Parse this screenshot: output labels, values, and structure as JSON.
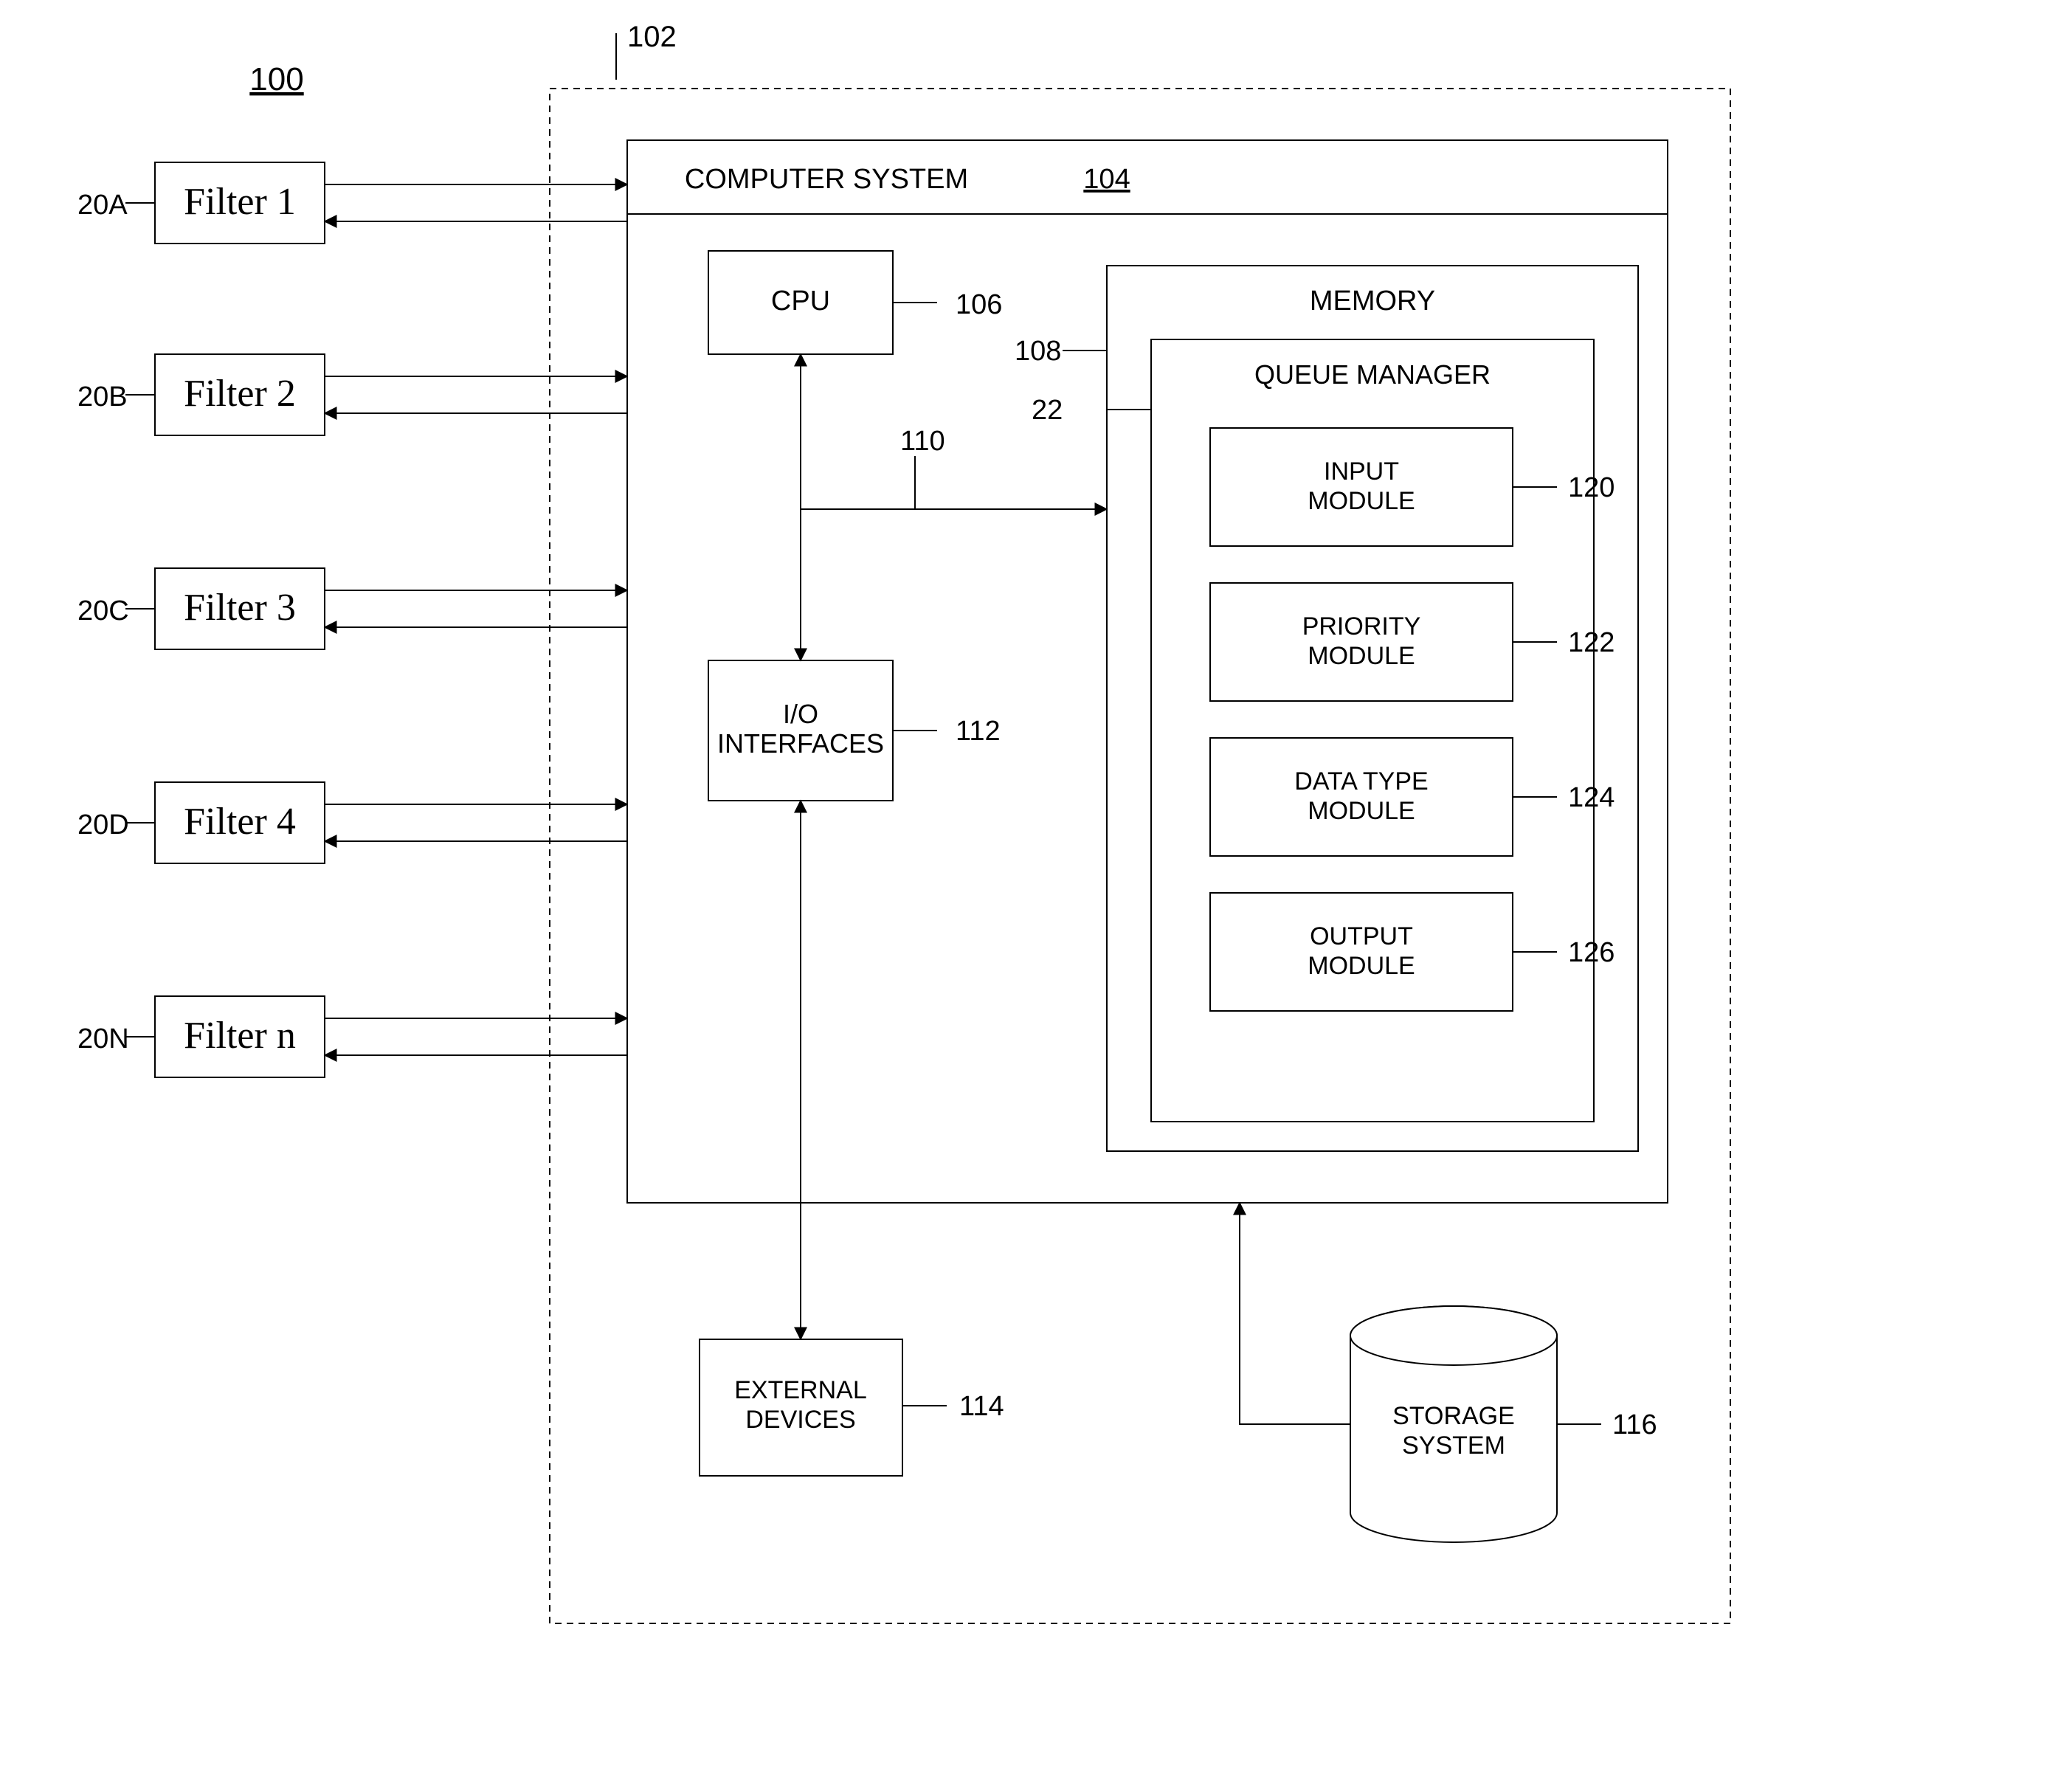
{
  "figure_ref": "100",
  "boundary_ref": "102",
  "filters": [
    {
      "id_label": "20A",
      "name": "Filter 1"
    },
    {
      "id_label": "20B",
      "name": "Filter 2"
    },
    {
      "id_label": "20C",
      "name": "Filter 3"
    },
    {
      "id_label": "20D",
      "name": "Filter 4"
    },
    {
      "id_label": "20N",
      "name": "Filter n"
    }
  ],
  "computer_system": {
    "title": "COMPUTER SYSTEM",
    "ref": "104",
    "cpu": {
      "label": "CPU",
      "ref": "106"
    },
    "bus_ref": "110",
    "io": {
      "label": "I/O INTERFACES",
      "ref": "112"
    },
    "memory": {
      "label": "MEMORY",
      "ref": "108",
      "queue_manager": {
        "label": "QUEUE MANAGER",
        "ref": "22",
        "modules": [
          {
            "label": "INPUT MODULE",
            "ref": "120"
          },
          {
            "label": "PRIORITY MODULE",
            "ref": "122"
          },
          {
            "label": "DATA TYPE MODULE",
            "ref": "124"
          },
          {
            "label": "OUTPUT MODULE",
            "ref": "126"
          }
        ]
      }
    }
  },
  "external_devices": {
    "label": "EXTERNAL DEVICES",
    "ref": "114"
  },
  "storage_system": {
    "label": "STORAGE SYSTEM",
    "ref": "116"
  }
}
